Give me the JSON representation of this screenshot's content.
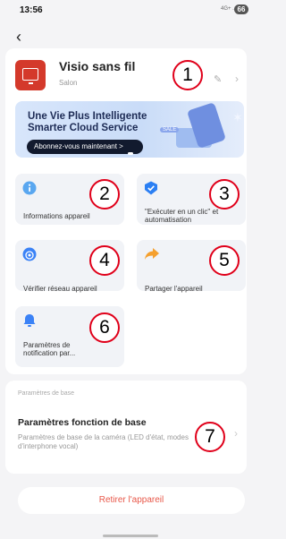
{
  "status_bar": {
    "time": "13:56",
    "signal": "4G+ .ıl",
    "battery": "66"
  },
  "device": {
    "name": "Visio sans fil",
    "room": "Salon"
  },
  "banner": {
    "title_line1": "Une Vie Plus Intelligente",
    "title_line2": "Smarter Cloud Service",
    "cta": "Abonnez-vous maintenant >",
    "badge": "SALE"
  },
  "tiles": [
    {
      "label": "Informations appareil",
      "icon": "info-icon",
      "color": "#5aa7f0"
    },
    {
      "label": "\"Exécuter en un clic\" et automatisation",
      "icon": "check-shield-icon",
      "color": "#2b7ff3"
    },
    {
      "label": "Vérifier réseau appareil",
      "icon": "network-icon",
      "color": "#3b82f6"
    },
    {
      "label": "Partager l'appareil",
      "icon": "share-icon",
      "color": "#f5a02e"
    },
    {
      "label": "Paramètres de notification par...",
      "icon": "bell-icon",
      "color": "#3b82f6"
    }
  ],
  "annotations": [
    "1",
    "2",
    "3",
    "4",
    "5",
    "6",
    "7"
  ],
  "basic": {
    "section_label": "Paramètres de base",
    "title": "Paramètres fonction de base",
    "subtitle": "Paramètres de base de la caméra (LED d'état, modes d'interphone vocal)"
  },
  "remove_label": "Retirer l'appareil",
  "colors": {
    "accent": "#e8584a",
    "annotation": "#e0001a",
    "device_icon": "#d4392b"
  }
}
